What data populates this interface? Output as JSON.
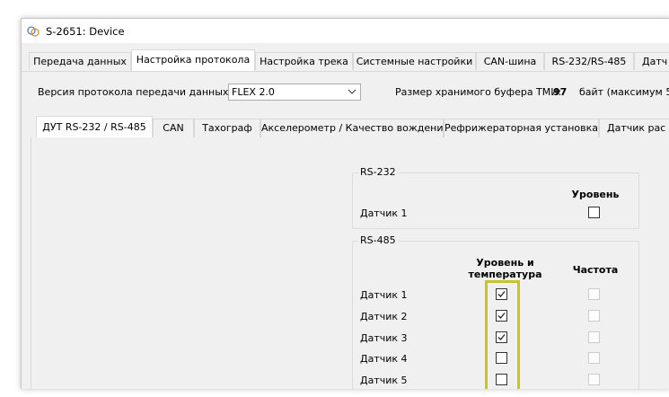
{
  "window": {
    "title": "S-2651: Device",
    "app_icon": "device-app-icon"
  },
  "main_tabs": [
    {
      "label": "Передача данных",
      "active": false
    },
    {
      "label": "Настройка протокола",
      "active": true
    },
    {
      "label": "Настройка трека",
      "active": false
    },
    {
      "label": "Системные настройки",
      "active": false
    },
    {
      "label": "CAN-шина",
      "active": false
    },
    {
      "label": "RS-232/RS-485",
      "active": false
    },
    {
      "label": "Датч",
      "active": false
    }
  ],
  "protocol": {
    "version_label": "Версия протокола передачи данных",
    "version_value": "FLEX 2.0",
    "buffer_label": "Размер хранимого буфера ТМИ:",
    "buffer_value": "97",
    "buffer_suffix": "байт (максимум 51"
  },
  "sub_tabs": [
    {
      "label": "ДУТ RS-232 / RS-485",
      "active": true
    },
    {
      "label": "CAN",
      "active": false
    },
    {
      "label": "Тахограф",
      "active": false
    },
    {
      "label": "Акселерометр / Качество вождения",
      "active": false
    },
    {
      "label": "Рефрижераторная установка",
      "active": false
    },
    {
      "label": "Датчик рас",
      "active": false
    }
  ],
  "rs232": {
    "title": "RS-232",
    "column_level": "Уровень",
    "rows": [
      {
        "label": "Датчик 1",
        "level": false
      }
    ]
  },
  "rs485": {
    "title": "RS-485",
    "column_level_temp_line1": "Уровень и",
    "column_level_temp_line2": "температура",
    "column_frequency": "Частота",
    "rows": [
      {
        "label": "Датчик 1",
        "level_temp": true,
        "frequency": false
      },
      {
        "label": "Датчик 2",
        "level_temp": true,
        "frequency": false
      },
      {
        "label": "Датчик 3",
        "level_temp": true,
        "frequency": false
      },
      {
        "label": "Датчик 4",
        "level_temp": false,
        "frequency": false
      },
      {
        "label": "Датчик 5",
        "level_temp": false,
        "frequency": false
      }
    ]
  },
  "colors": {
    "highlight": "#c5c52a",
    "window_bg": "#f0f0f0"
  }
}
